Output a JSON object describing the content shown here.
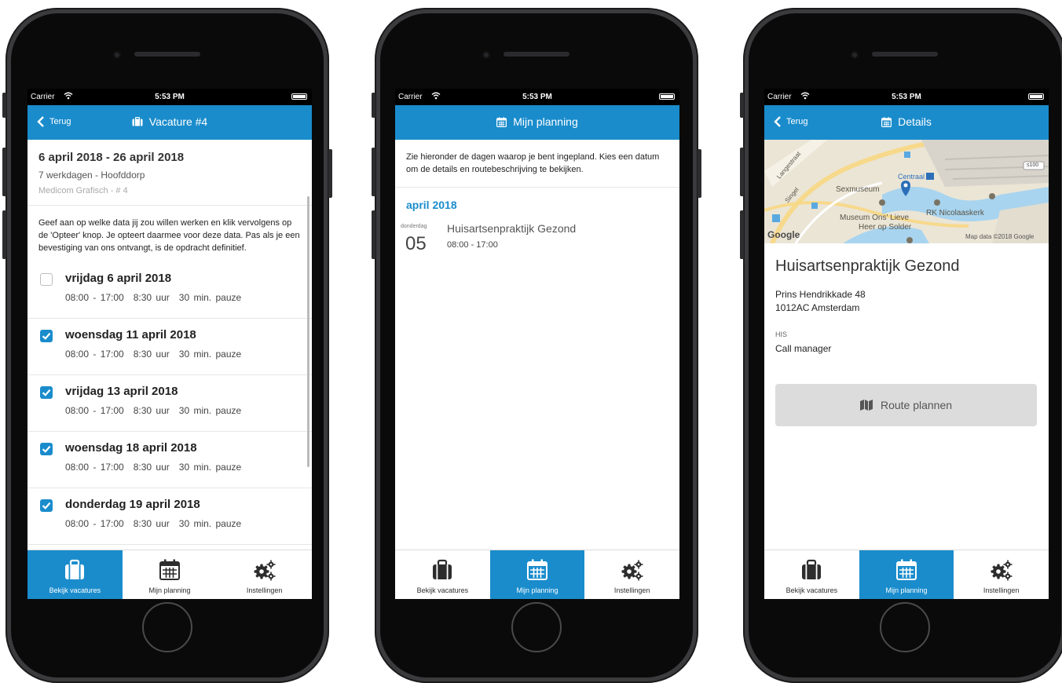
{
  "status_bar": {
    "carrier": "Carrier",
    "time": "5:53 PM"
  },
  "tabs": [
    {
      "label": "Bekijk vacatures",
      "icon": "briefcase-icon"
    },
    {
      "label": "Mijn planning",
      "icon": "calendar-icon"
    },
    {
      "label": "Instellingen",
      "icon": "gears-icon"
    }
  ],
  "colors": {
    "accent": "#1a8ccc",
    "status_bar": "#000000",
    "phone_frame": "#3b3b3d"
  },
  "screen1": {
    "back_label": "Terug",
    "title": "Vacature #4",
    "date_range": "6 april 2018 - 26 april 2018",
    "days_location": "7 werkdagen - Hoofddorp",
    "company": "Medicom Grafisch - # 4",
    "intro": "Geef aan op welke data jij zou willen werken en klik vervolgens op de 'Opteer' knop. Je opteert daarmee voor deze data. Pas als je een bevestiging van ons ontvangt, is de opdracht definitief.",
    "days": [
      {
        "label": "vrijdag 6 april 2018",
        "time": "08:00 - 17:00",
        "hours": "8:30 uur",
        "pause": "30 min. pauze",
        "checked": false
      },
      {
        "label": "woensdag 11 april 2018",
        "time": "08:00 - 17:00",
        "hours": "8:30 uur",
        "pause": "30 min. pauze",
        "checked": true
      },
      {
        "label": "vrijdag 13 april 2018",
        "time": "08:00 - 17:00",
        "hours": "8:30 uur",
        "pause": "30 min. pauze",
        "checked": true
      },
      {
        "label": "woensdag 18 april 2018",
        "time": "08:00 - 17:00",
        "hours": "8:30 uur",
        "pause": "30 min. pauze",
        "checked": true
      },
      {
        "label": "donderdag 19 april 2018",
        "time": "08:00 - 17:00",
        "hours": "8:30 uur",
        "pause": "30 min. pauze",
        "checked": true
      }
    ],
    "active_tab": 0
  },
  "screen2": {
    "title": "Mijn planning",
    "intro": "Zie hieronder de dagen waarop je bent ingepland. Kies een datum om de details en routebeschrijving te bekijken.",
    "month": "april 2018",
    "entry": {
      "weekday": "donderdag",
      "day": "05",
      "name": "Huisartsenpraktijk Gezond",
      "time": "08:00 - 17:00"
    },
    "active_tab": 1
  },
  "screen3": {
    "back_label": "Terug",
    "title": "Details",
    "map": {
      "labels": [
        "Langestraat",
        "Singel",
        "Sexmuseum",
        "Centraal",
        "Museum Ons' Lieve",
        "Heer op Solder",
        "RK Nicolaaskerk",
        "s100"
      ],
      "google": "Google",
      "attribution": "Map data ©2018 Google"
    },
    "place": "Huisartsenpraktijk Gezond",
    "street": "Prins Hendrikkade 48",
    "city": "1012AC Amsterdam",
    "his_label": "HIS",
    "his_value": "Call manager",
    "route_button": "Route plannen",
    "active_tab": 1
  }
}
